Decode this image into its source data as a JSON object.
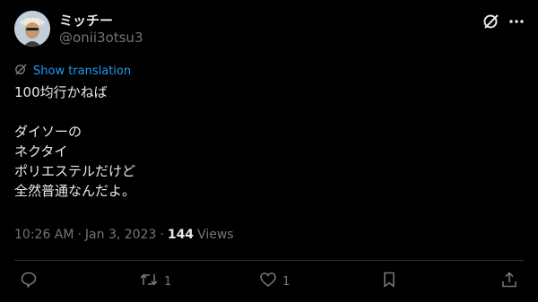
{
  "author": {
    "display_name": "ミッチー",
    "handle": "@onii3otsu3"
  },
  "translate": {
    "label": "Show translation"
  },
  "tweet": {
    "lines": [
      "100均行かねば",
      "",
      "ダイソーの",
      "ネクタイ",
      "ポリエステルだけど",
      "全然普通なんだよ。"
    ]
  },
  "meta": {
    "time": "10:26 AM",
    "sep1": "·",
    "date": "Jan 3, 2023",
    "sep2": "·",
    "views_count": "144",
    "views_label": "Views"
  },
  "actions": {
    "retweet_count": "1",
    "like_count": "1"
  },
  "colors": {
    "background": "#000000",
    "text": "#e7e9ea",
    "muted": "#71767b",
    "accent": "#1d9bf0",
    "divider": "#2f3336"
  },
  "icons": [
    "grok-icon",
    "more-icon",
    "translate-icon",
    "reply-icon",
    "retweet-icon",
    "like-icon",
    "bookmark-icon",
    "share-icon"
  ]
}
